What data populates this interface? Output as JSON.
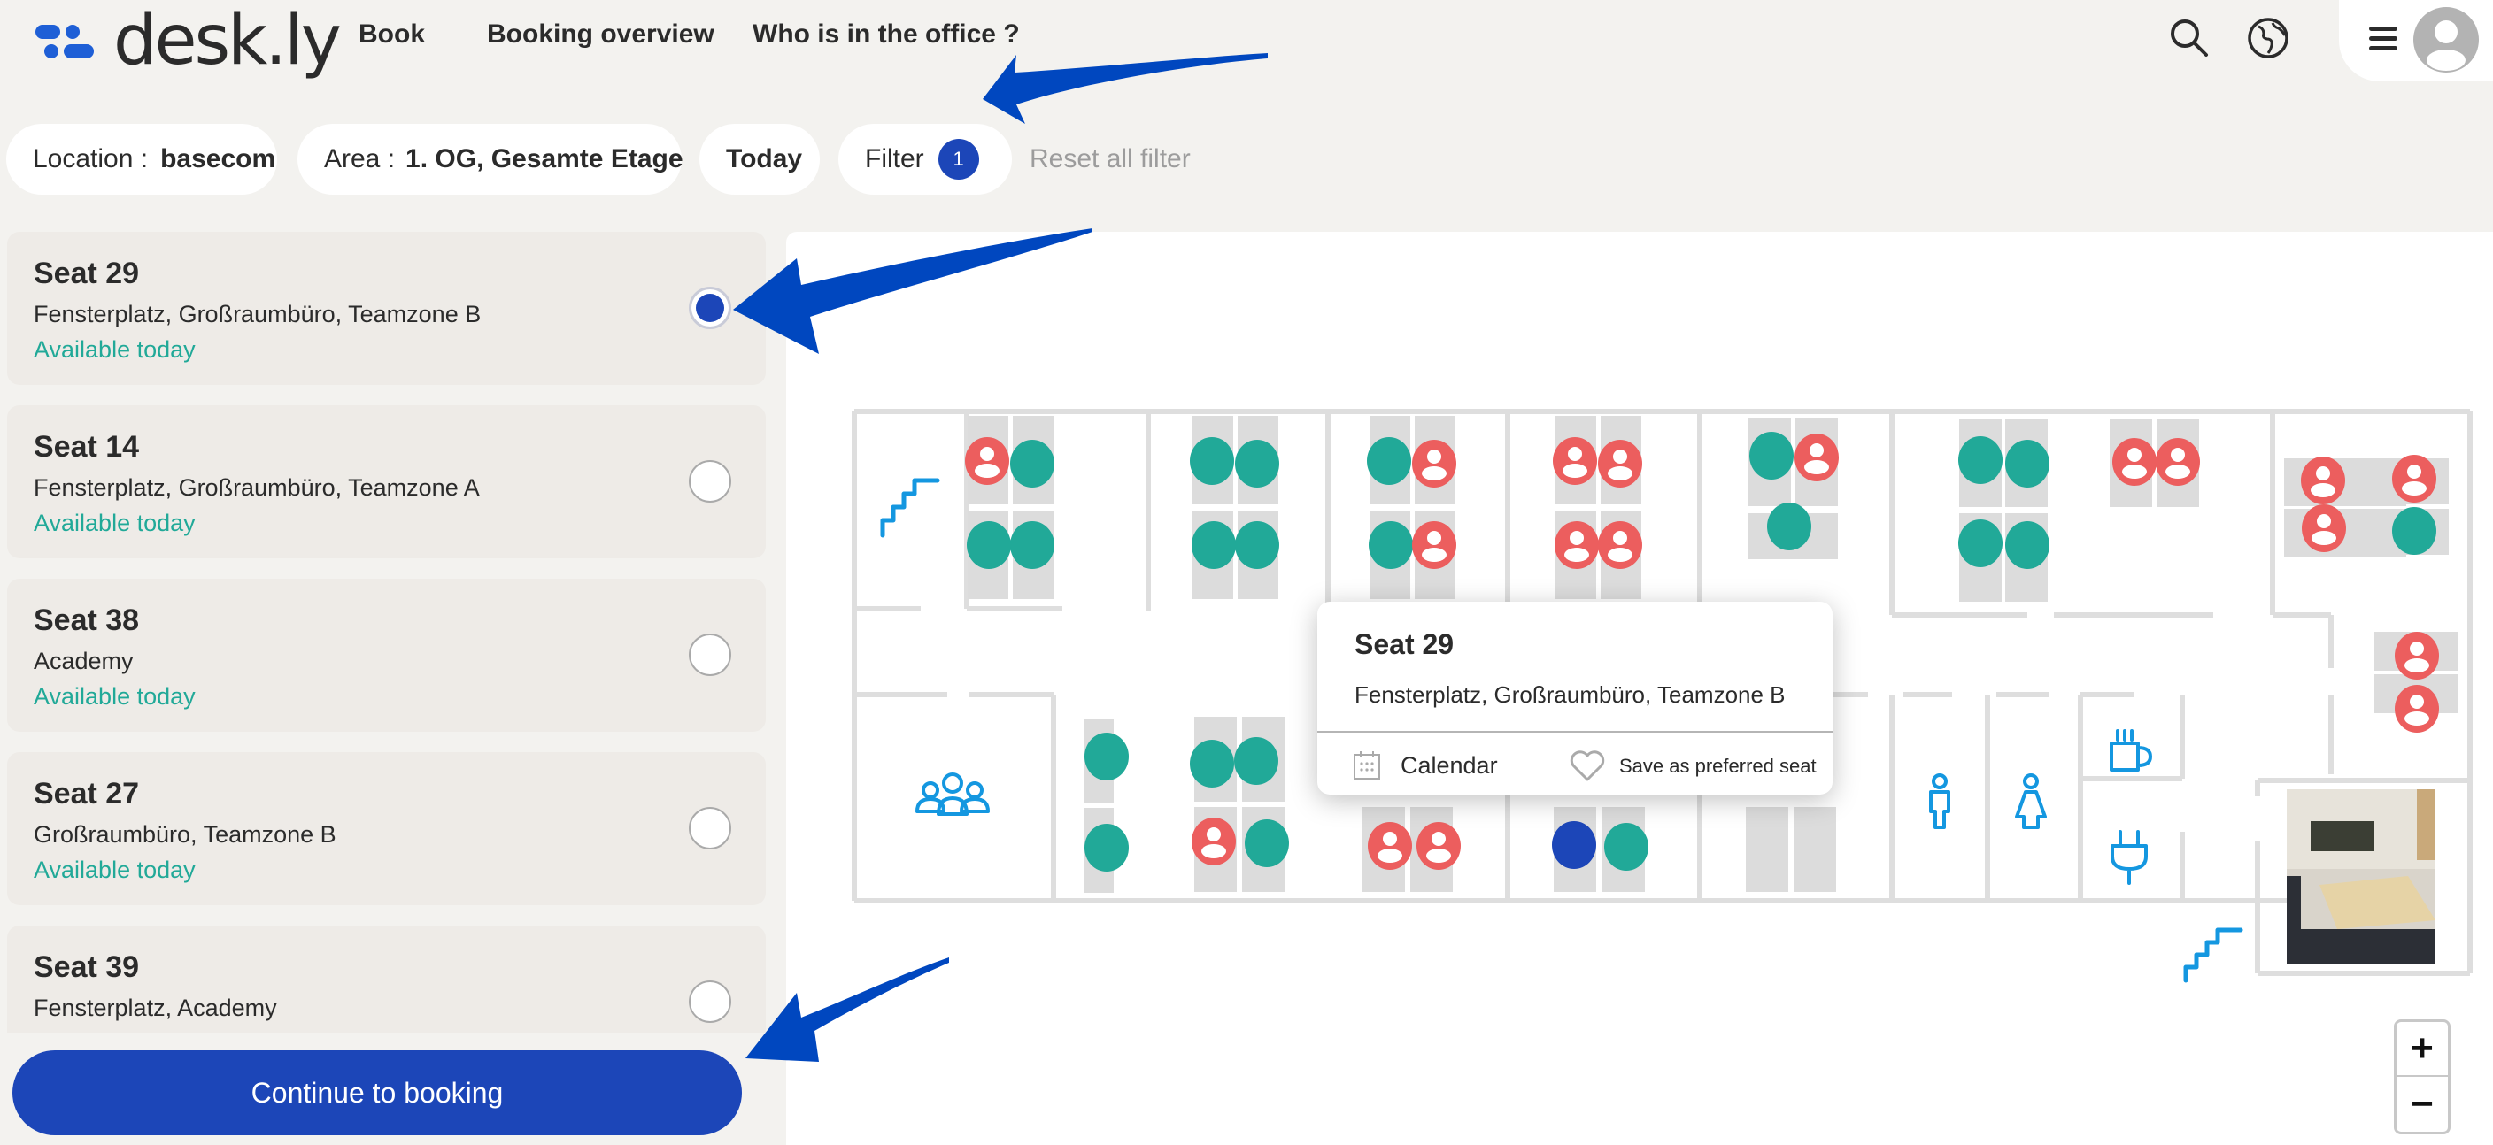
{
  "app": {
    "logo_text": "desk.ly"
  },
  "nav": {
    "items": [
      {
        "label": "Book"
      },
      {
        "label": "Booking overview"
      },
      {
        "label": "Who is in the office ?"
      }
    ]
  },
  "header_icons": [
    "search-icon",
    "globe-icon",
    "menu-icon",
    "avatar"
  ],
  "filters": {
    "location_label": "Location :",
    "location_value": "basecom",
    "area_label": "Area :",
    "area_value": "1. OG, Gesamte Etage",
    "date_value": "Today",
    "filter_label": "Filter",
    "filter_count": "1",
    "reset_label": "Reset all filter"
  },
  "seats": [
    {
      "title": "Seat 29",
      "desc": "Fensterplatz, Großraumbüro, Teamzone B",
      "status": "Available today",
      "selected": true
    },
    {
      "title": "Seat 14",
      "desc": "Fensterplatz, Großraumbüro, Teamzone A",
      "status": "Available today",
      "selected": false
    },
    {
      "title": "Seat 38",
      "desc": "Academy",
      "status": "Available today",
      "selected": false
    },
    {
      "title": "Seat 27",
      "desc": "Großraumbüro, Teamzone B",
      "status": "Available today",
      "selected": false
    },
    {
      "title": "Seat 39",
      "desc": "Fensterplatz, Academy",
      "status": "",
      "selected": false
    }
  ],
  "continue_label": "Continue to booking",
  "tooltip": {
    "title": "Seat 29",
    "desc": "Fensterplatz, Großraumbüro, Teamzone B",
    "calendar_label": "Calendar",
    "favorite_label": "Save as preferred seat"
  },
  "zoom": {
    "in_label": "+",
    "out_label": "−"
  },
  "colors": {
    "primary": "#1c46b8",
    "available": "#21a998",
    "occupied": "#ec5e5e",
    "icon_blue": "#1497e0",
    "desk": "#dcdcdc",
    "wall": "#dedede",
    "annotation_arrow": "#0047bf"
  },
  "map": {
    "legend_states": [
      "available",
      "occupied",
      "selected"
    ],
    "seats_top_row": [
      [
        "occupied",
        "available",
        "available",
        "available"
      ],
      [
        "available",
        "available",
        "available",
        "available"
      ],
      [
        "available",
        "occupied",
        "available",
        "occupied"
      ],
      [
        "occupied",
        "occupied",
        "occupied",
        "occupied"
      ],
      [
        "available",
        "occupied",
        "available"
      ],
      [
        "available",
        "available",
        "available",
        "available"
      ],
      [
        "occupied",
        "occupied"
      ],
      [
        "occupied",
        "occupied",
        "occupied",
        "available"
      ]
    ],
    "seats_bottom_row": [
      [
        "available",
        "available"
      ],
      [
        "available",
        "available",
        "occupied",
        "available"
      ],
      [
        "occupied",
        "occupied"
      ],
      [
        "selected",
        "available"
      ],
      [
        "occupied",
        "occupied"
      ]
    ],
    "amenities": [
      "stairs-icon",
      "meeting-room-icon",
      "male-restroom-icon",
      "female-restroom-icon",
      "coffee-icon",
      "power-plug-icon",
      "stairs-icon",
      "conference-room-photo"
    ]
  }
}
